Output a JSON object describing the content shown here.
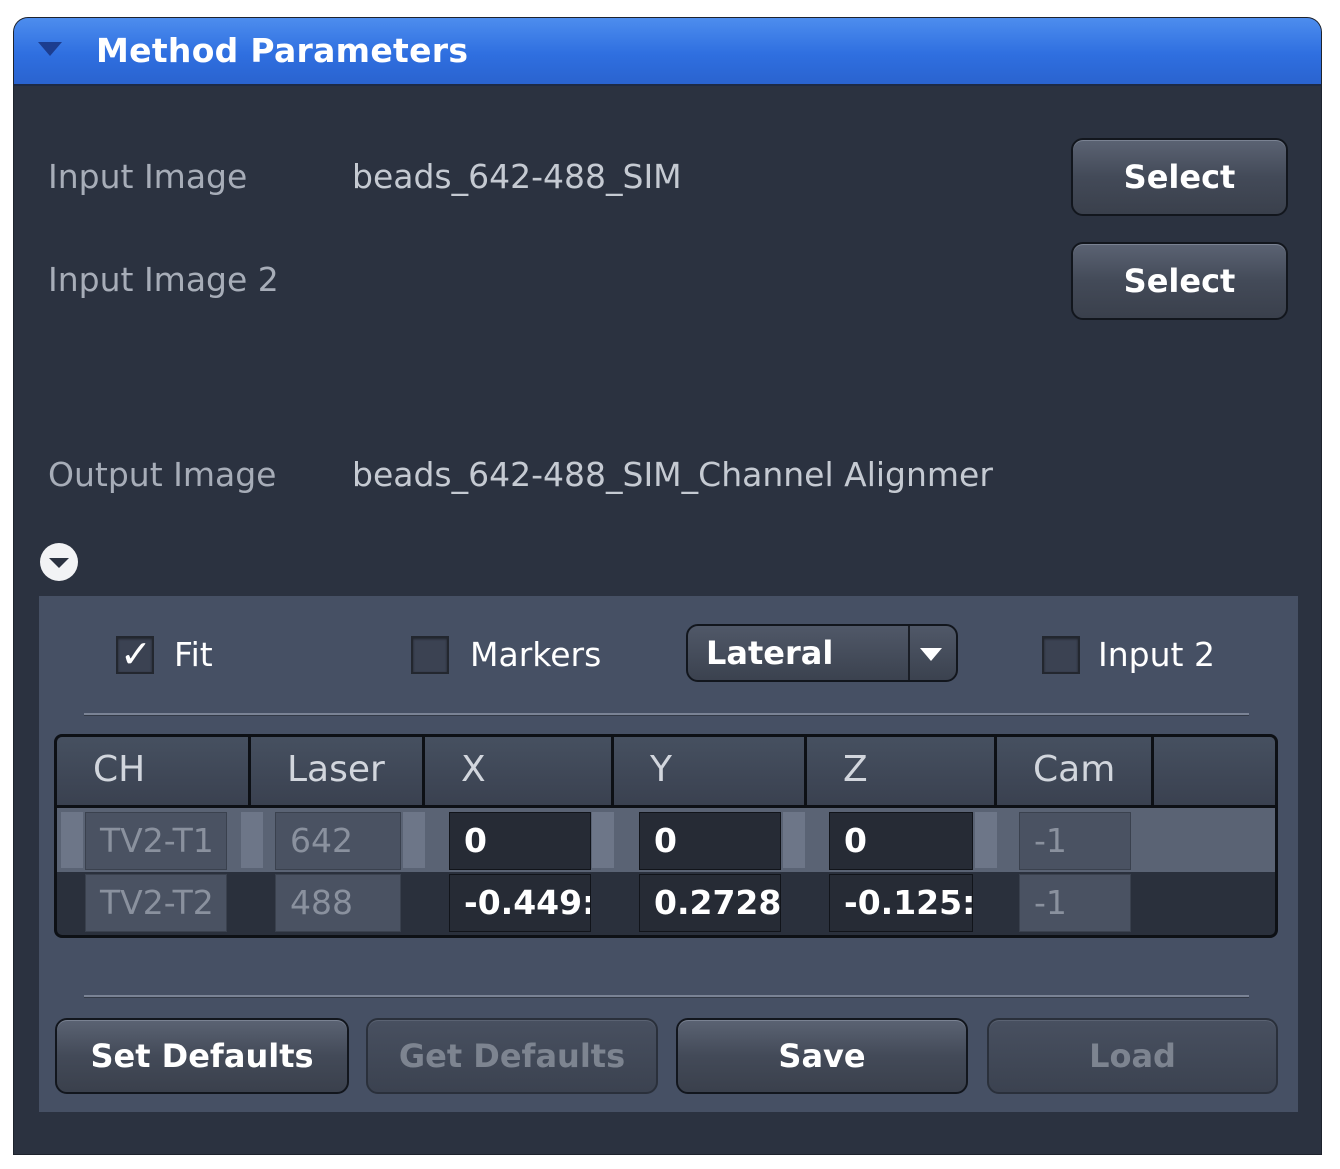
{
  "panel": {
    "title": "Method Parameters"
  },
  "inputs": {
    "input_image_label": "Input Image",
    "input_image_value": "beads_642-488_SIM",
    "input_image_2_label": "Input Image 2",
    "input_image_2_value": "",
    "output_image_label": "Output Image",
    "output_image_value": "beads_642-488_SIM_Channel Alignmer",
    "select_label_1": "Select",
    "select_label_2": "Select"
  },
  "options": {
    "fit_label": "Fit",
    "fit_checked": true,
    "markers_label": "Markers",
    "markers_checked": false,
    "mode_value": "Lateral",
    "input2_label": "Input 2",
    "input2_checked": false
  },
  "table": {
    "columns": [
      "CH",
      "Laser",
      "X",
      "Y",
      "Z",
      "Cam"
    ],
    "rows": [
      {
        "ch": "TV2-T1",
        "laser": "642",
        "x": "0",
        "y": "0",
        "z": "0",
        "cam": "-1"
      },
      {
        "ch": "TV2-T2",
        "laser": "488",
        "x": "-0.449:",
        "y": "0.2728",
        "z": "-0.125:",
        "cam": "-1"
      }
    ]
  },
  "actions": {
    "set_defaults": "Set Defaults",
    "get_defaults": "Get Defaults",
    "save": "Save",
    "load": "Load"
  },
  "colors": {
    "titlebar": "#2f6fe0",
    "panel_bg": "#2b3240",
    "subpanel_bg": "#465064"
  }
}
